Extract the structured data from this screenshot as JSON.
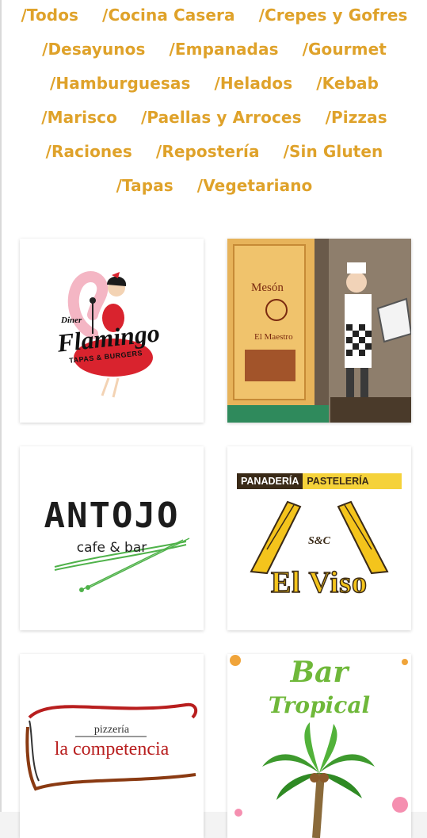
{
  "filters": [
    [
      "/Todos",
      "/Cocina Casera",
      "/Crepes y Gofres"
    ],
    [
      "/Desayunos",
      "/Empanadas",
      "/Gourmet"
    ],
    [
      "/Hamburguesas",
      "/Helados",
      "/Kebab"
    ],
    [
      "/Marisco",
      "/Paellas y Arroces",
      "/Pizzas"
    ],
    [
      "/Raciones",
      "/Repostería",
      "/Sin Gluten"
    ],
    [
      "/Tapas",
      "/Vegetariano"
    ]
  ],
  "colors": {
    "accent": "#dfa22a",
    "background": "#ffffff"
  },
  "cards": {
    "flamingo": {
      "line1": "Diner",
      "line2": "Flamingo",
      "line3": "TAPAS & BURGERS"
    },
    "meson": {
      "line1": "Mesón",
      "line2": "El Maestro"
    },
    "antojo": {
      "title": "ANTOJO",
      "subtitle": "cafe & bar"
    },
    "elviso": {
      "left": "PANADERÍA",
      "right": "PASTELERÍA",
      "sc": "S&C",
      "name": "El Viso"
    },
    "competencia": {
      "small": "pizzería",
      "big": "la competencia"
    },
    "tropical": {
      "line1": "Bar",
      "line2": "Tropical"
    }
  }
}
